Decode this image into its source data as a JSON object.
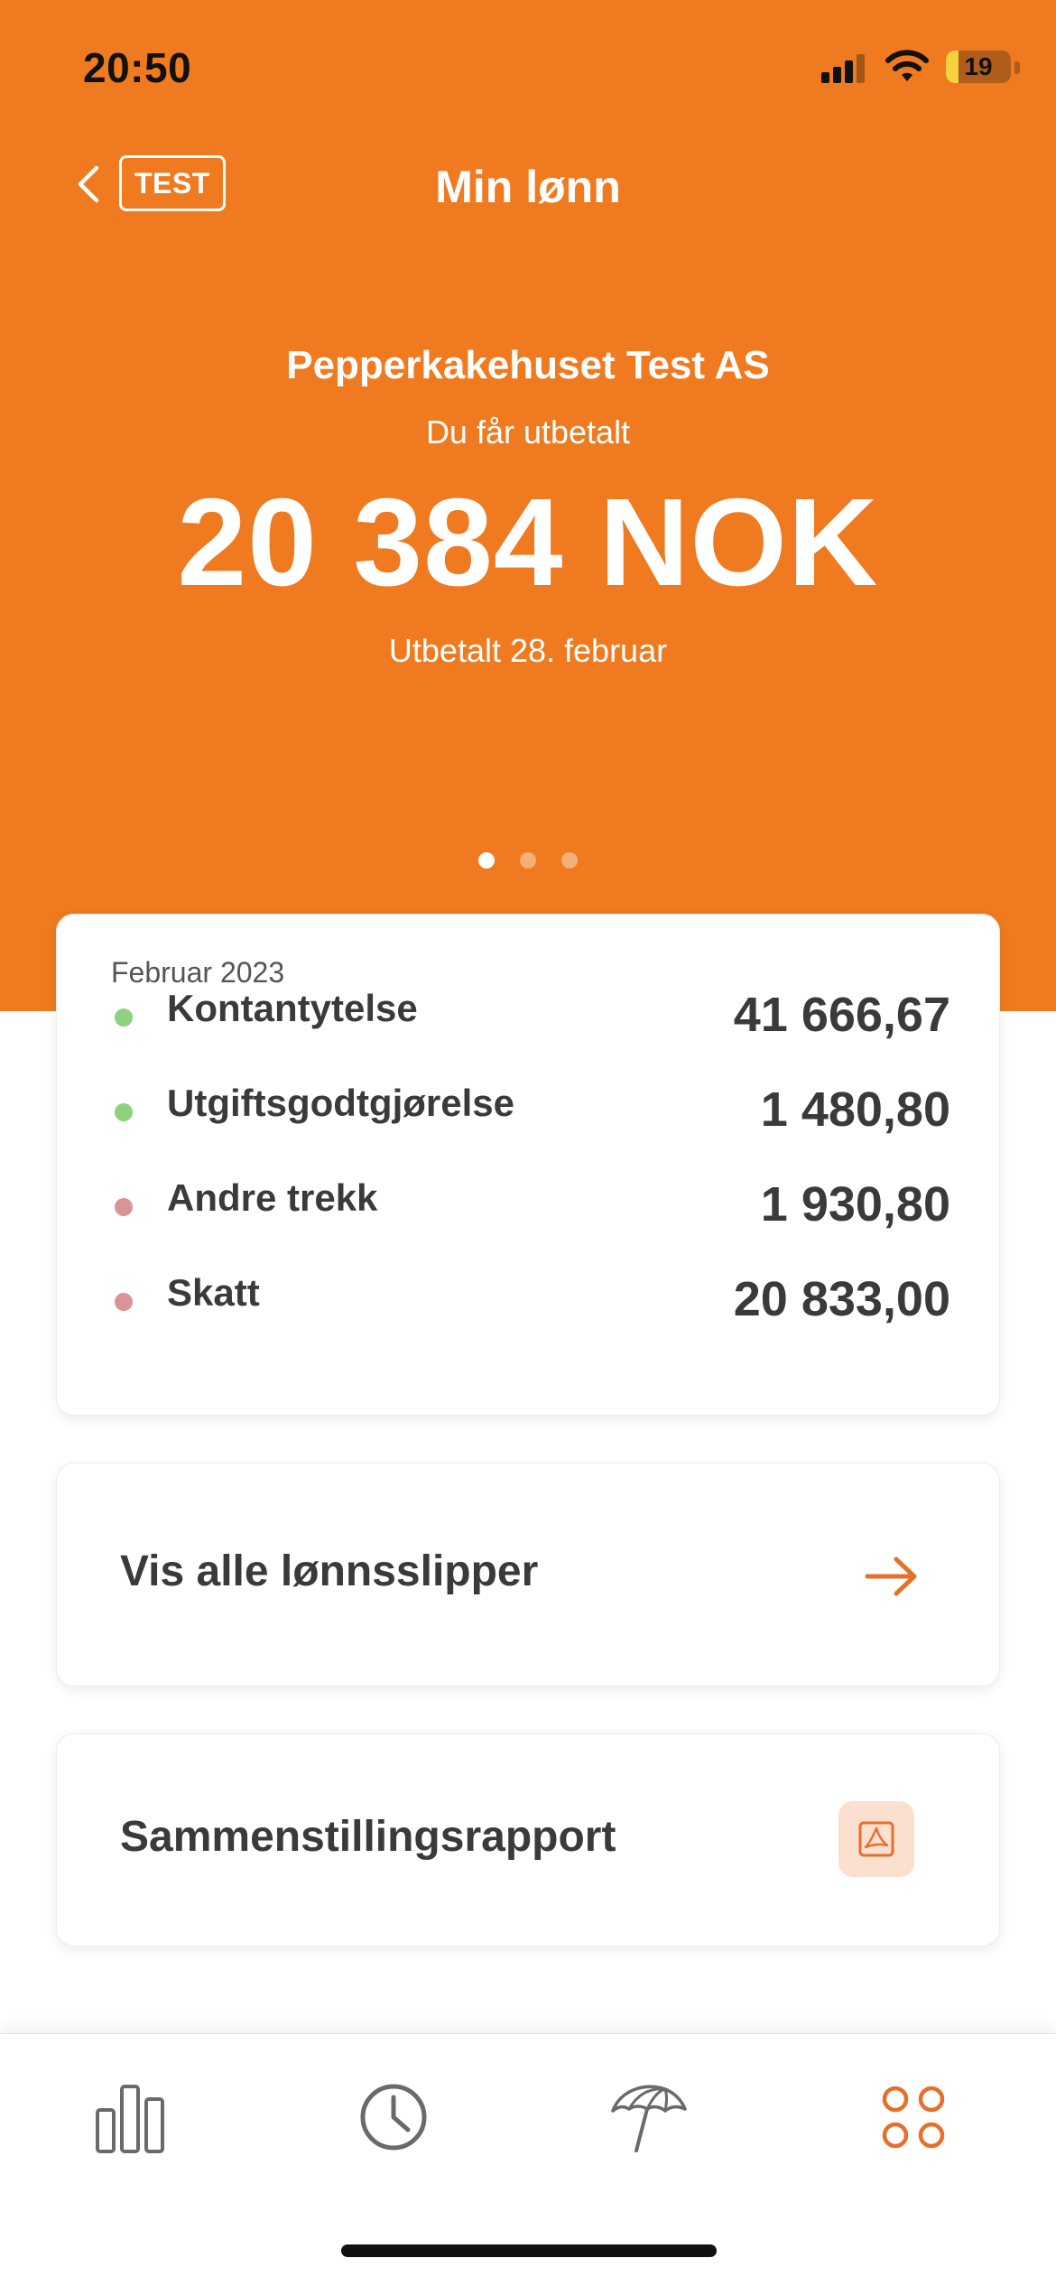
{
  "status": {
    "time": "20:50",
    "battery": "19",
    "battery_fraction": 0.19
  },
  "nav": {
    "back_icon": "chevron-left-icon",
    "badge": "TEST",
    "title": "Min lønn"
  },
  "hero": {
    "company": "Pepperkakehuset Test AS",
    "payout_label": "Du får utbetalt",
    "payout_amount": "20 384 NOK",
    "paid_date": "Utbetalt 28. februar",
    "pager": {
      "count": 3,
      "active": 0
    }
  },
  "summary": {
    "month": "Februar 2023",
    "rows": [
      {
        "label": "Kontantytelse",
        "value": "41 666,67",
        "color": "#8ED27E"
      },
      {
        "label": "Utgiftsgodtgjørelse",
        "value": "1 480,80",
        "color": "#8ED27E"
      },
      {
        "label": "Andre trekk",
        "value": "1 930,80",
        "color": "#D99498"
      },
      {
        "label": "Skatt",
        "value": "20 833,00",
        "color": "#D99498"
      }
    ]
  },
  "actions": {
    "payslips_label": "Vis alle lønnsslipper",
    "payslips_icon": "arrow-right-icon",
    "report_label": "Sammenstillingsrapport",
    "report_icon": "pdf-icon"
  },
  "tabs": [
    {
      "icon": "bar-chart-icon",
      "active": false
    },
    {
      "icon": "clock-icon",
      "active": false
    },
    {
      "icon": "umbrella-icon",
      "active": false
    },
    {
      "icon": "apps-grid-icon",
      "active": true
    }
  ],
  "colors": {
    "brand": "#EF7A1F",
    "accent_icon": "#E56F2B",
    "inactive_icon": "#6a6a6a",
    "text": "#3a3a3a"
  }
}
